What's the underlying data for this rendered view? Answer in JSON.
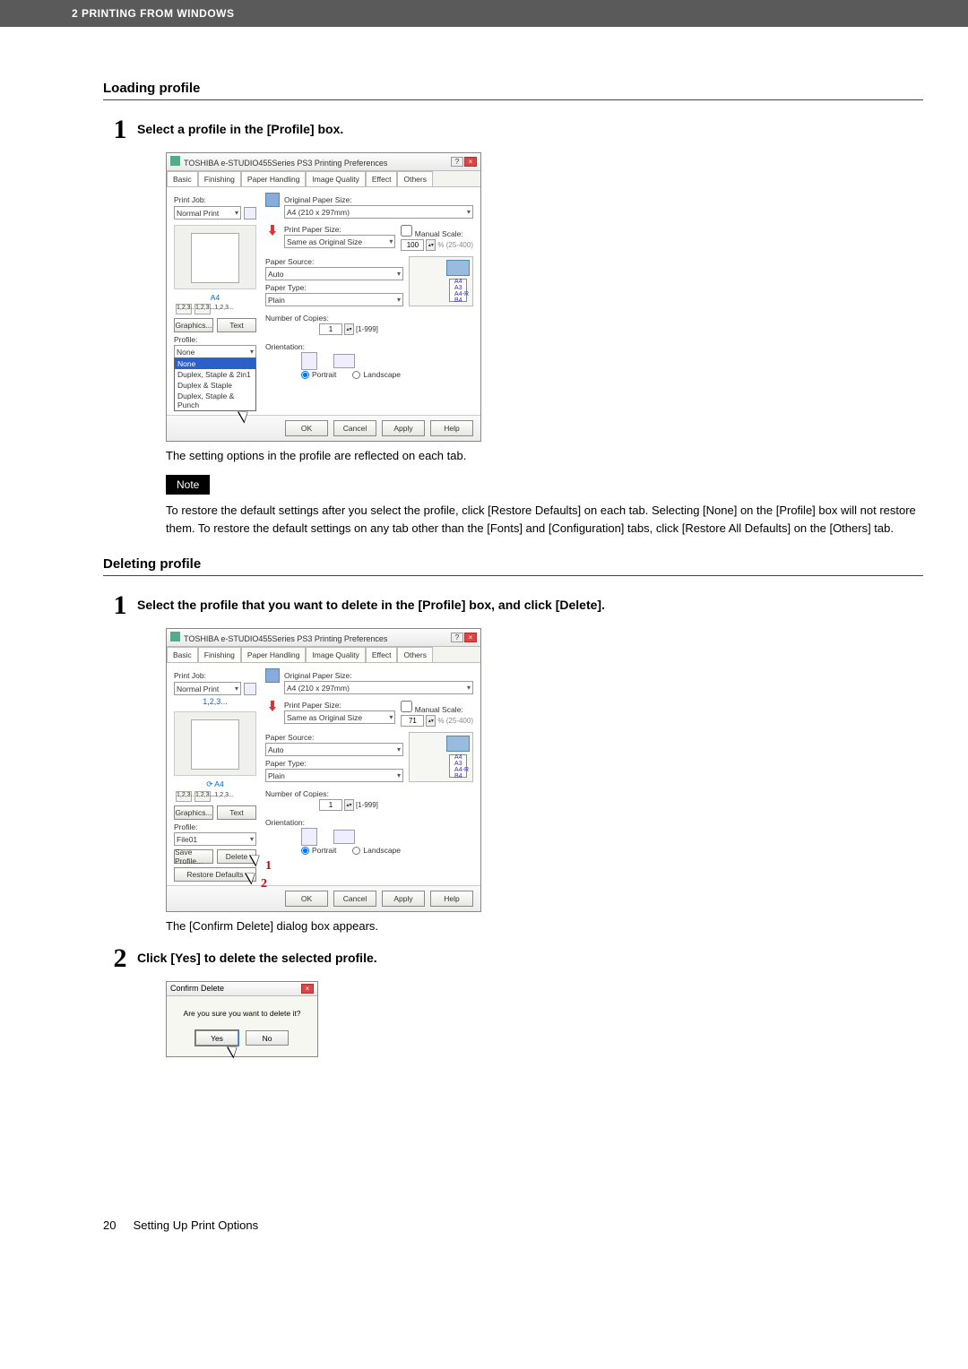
{
  "header": {
    "chapter": "2 PRINTING FROM WINDOWS"
  },
  "sections": {
    "loading": {
      "heading": "Loading profile"
    },
    "deleting": {
      "heading": "Deleting profile"
    }
  },
  "steps": {
    "load1": {
      "num": "1",
      "text": "Select a profile in the [Profile] box."
    },
    "del1": {
      "num": "1",
      "text": "Select the profile that you want to delete in the [Profile] box, and click [Delete]."
    },
    "del2": {
      "num": "2",
      "text": "Click [Yes] to delete the selected profile."
    }
  },
  "captions": {
    "load_after": "The setting options in the profile are reflected on each tab.",
    "del_after": "The [Confirm Delete] dialog box appears."
  },
  "note": {
    "badge": "Note",
    "text": "To restore the default settings after you select the profile, click [Restore Defaults] on each tab. Selecting [None] on the [Profile] box will not restore them. To restore the default settings on any tab other than the [Fonts] and [Configuration] tabs, click [Restore All Defaults] on the [Others] tab."
  },
  "dialog": {
    "title": "TOSHIBA e-STUDIO455Series PS3 Printing Preferences",
    "tabs": [
      "Basic",
      "Finishing",
      "Paper Handling",
      "Image Quality",
      "Effect",
      "Others"
    ],
    "print_job_label": "Print Job:",
    "print_job_value": "Normal Print",
    "preview_size": "A4",
    "preview_tiny": "1,2,3...1,2,3...",
    "graphics_btn": "Graphics...",
    "text_btn": "Text",
    "profile_label": "Profile:",
    "profile_value_none": "None",
    "profile_value_file": "File01",
    "dropdown_items": [
      "None",
      "Duplex, Staple & 2in1",
      "Duplex & Staple",
      "Duplex, Staple & Punch"
    ],
    "save_profile_btn": "Save Profile...",
    "delete_btn": "Delete",
    "restore_btn": "Restore Defaults",
    "orig_size_label": "Original Paper Size:",
    "orig_size_value": "A4 (210 x 297mm)",
    "print_size_label": "Print Paper Size:",
    "print_size_value": "Same as Original Size",
    "manual_scale_label": "Manual Scale:",
    "scale_value_a": "100",
    "scale_value_b": "71",
    "scale_range": "% (25-400)",
    "paper_source_label": "Paper Source:",
    "paper_source_value": "Auto",
    "paper_type_label": "Paper Type:",
    "paper_type_value": "Plain",
    "copies_label": "Number of Copies:",
    "copies_value": "1",
    "copies_range": "[1-999]",
    "orientation_label": "Orientation:",
    "portrait": "Portrait",
    "landscape": "Landscape",
    "size_list": [
      "A4",
      "A3",
      "A4-R",
      "B4"
    ],
    "ok": "OK",
    "cancel": "Cancel",
    "apply": "Apply",
    "help": "Help",
    "marker1": "1",
    "marker2": "2"
  },
  "confirm": {
    "title": "Confirm Delete",
    "msg": "Are you sure you want to delete it?",
    "yes": "Yes",
    "no": "No"
  },
  "footer": {
    "page_num": "20",
    "title": "Setting Up Print Options"
  }
}
